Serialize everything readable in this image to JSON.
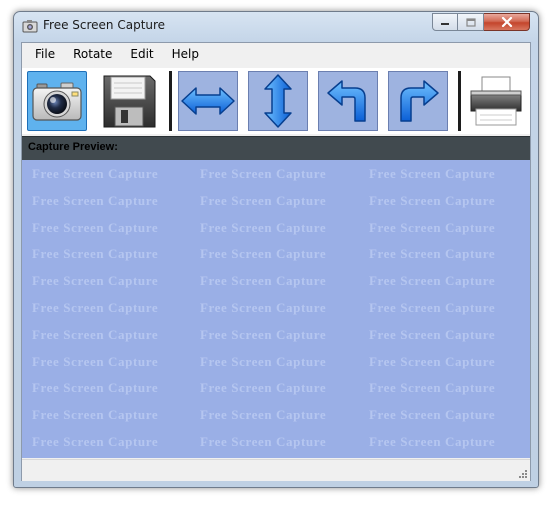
{
  "window": {
    "title": "Free Screen Capture"
  },
  "menu": {
    "items": [
      "File",
      "Rotate",
      "Edit",
      "Help"
    ]
  },
  "toolbar": {
    "buttons": [
      {
        "name": "capture-button",
        "icon": "camera-icon"
      },
      {
        "name": "save-button",
        "icon": "floppy-disk-icon"
      },
      {
        "name": "flip-horizontal-button",
        "icon": "horizontal-arrows-icon"
      },
      {
        "name": "flip-vertical-button",
        "icon": "vertical-arrows-icon"
      },
      {
        "name": "rotate-left-button",
        "icon": "rotate-left-arrow-icon"
      },
      {
        "name": "rotate-right-button",
        "icon": "rotate-right-arrow-icon"
      },
      {
        "name": "print-button",
        "icon": "printer-icon"
      }
    ]
  },
  "preview": {
    "label": "Capture Preview:",
    "watermark": "Free Screen Capture"
  },
  "colors": {
    "preview_bg": "#9aafe6",
    "watermark": "#b5c6f0",
    "header_bar": "#414a4f",
    "camera_highlight": "#5fb2ee",
    "arrow_button": "#9eb3e0",
    "arrow_blue": "#1f7fe8"
  }
}
